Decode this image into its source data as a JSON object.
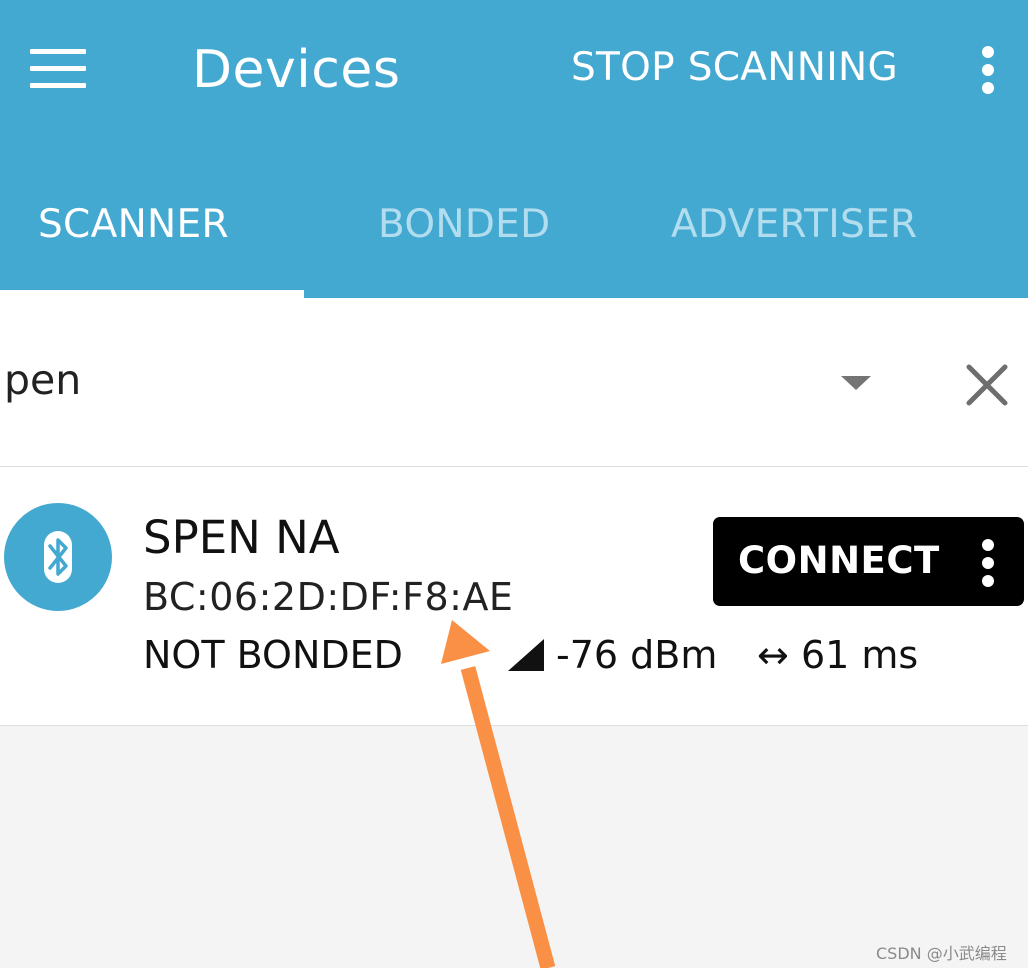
{
  "appbar": {
    "title": "Devices",
    "stop_scanning_label": "STOP SCANNING",
    "menu_icon": "hamburger-menu-icon",
    "overflow_icon": "vertical-dots-icon",
    "background_color": "#44a9d0"
  },
  "tabs": [
    {
      "label": "SCANNER",
      "active": true
    },
    {
      "label": "BONDED",
      "active": false
    },
    {
      "label": "ADVERTISER",
      "active": false
    }
  ],
  "filter": {
    "value": "pen",
    "dropdown_icon": "triangle-down-icon",
    "clear_icon": "close-icon"
  },
  "device": {
    "name": "SPEN NA",
    "address": "BC:06:2D:DF:F8:AE",
    "bond_state": "NOT BONDED",
    "rssi": "-76 dBm",
    "interval": "61 ms",
    "icon": "bluetooth-icon",
    "connect_label": "CONNECT"
  },
  "watermark": "CSDN @小武编程",
  "annotation_color": "#f99045"
}
